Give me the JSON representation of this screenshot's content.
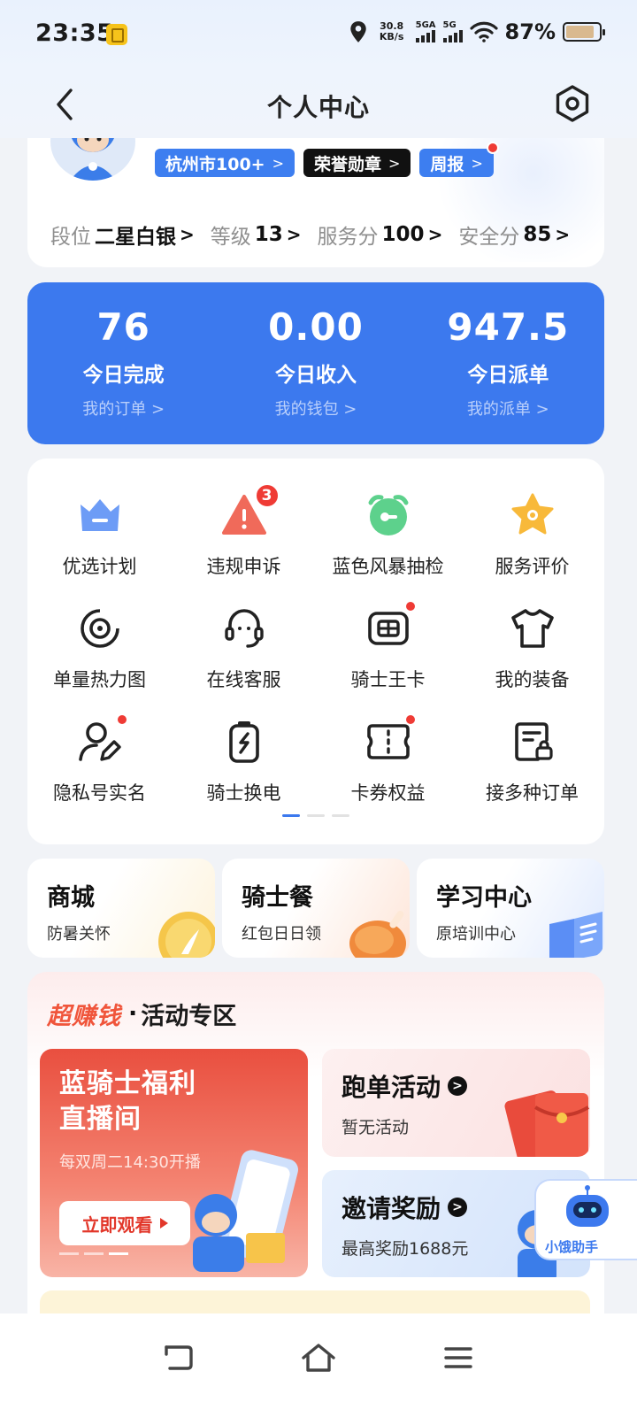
{
  "status_bar": {
    "time": "23:35",
    "net_speed_value": "30.8",
    "net_speed_unit": "KB/s",
    "sim1_label": "5GA",
    "sim2_label": "5G",
    "battery_percent": "87%",
    "battery_level": 0.87
  },
  "header": {
    "title": "个人中心"
  },
  "profile": {
    "tags": [
      {
        "label": "杭州市100+"
      },
      {
        "label": "荣誉勋章"
      },
      {
        "label": "周报"
      }
    ],
    "stats": [
      {
        "label": "段位",
        "value": "二星白银"
      },
      {
        "label": "等级",
        "value": "13"
      },
      {
        "label": "服务分",
        "value": "100"
      },
      {
        "label": "安全分",
        "value": "85"
      }
    ]
  },
  "today": [
    {
      "number": "76",
      "name": "今日完成",
      "link": "我的订单 >"
    },
    {
      "number": "0.00",
      "name": "今日收入",
      "link": "我的钱包 >"
    },
    {
      "number": "947.5",
      "name": "今日派单",
      "link": "我的派单 >"
    }
  ],
  "grid_items": [
    {
      "label": "优选计划",
      "icon": "crown-icon"
    },
    {
      "label": "违规申诉",
      "icon": "warning-icon",
      "badge": "3"
    },
    {
      "label": "蓝色风暴抽检",
      "icon": "alarm-clock-icon"
    },
    {
      "label": "服务评价",
      "icon": "star-badge-icon"
    },
    {
      "label": "单量热力图",
      "icon": "target-icon"
    },
    {
      "label": "在线客服",
      "icon": "headset-icon"
    },
    {
      "label": "骑士王卡",
      "icon": "sim-card-icon"
    },
    {
      "label": "我的装备",
      "icon": "tshirt-icon"
    },
    {
      "label": "隐私号实名",
      "icon": "user-edit-icon"
    },
    {
      "label": "骑士换电",
      "icon": "battery-swap-icon"
    },
    {
      "label": "卡券权益",
      "icon": "coupon-icon"
    },
    {
      "label": "接多种订单",
      "icon": "order-lock-icon"
    }
  ],
  "features": [
    {
      "title": "商城",
      "subtitle": "防暑关怀"
    },
    {
      "title": "骑士餐",
      "subtitle": "红包日日领"
    },
    {
      "title": "学习中心",
      "subtitle": "原培训中心"
    }
  ],
  "promo": {
    "title_highlight": "超赚钱",
    "title_dot": "·",
    "title_text": "活动专区",
    "live": {
      "line1": "蓝骑士福利",
      "line2": "直播间",
      "schedule": "每双周二14:30开播",
      "button": "立即观看"
    },
    "activities": [
      {
        "title": "跑单活动",
        "subtitle": "暂无活动"
      },
      {
        "title": "邀请奖励",
        "subtitle": "最高奖励1688元"
      }
    ]
  },
  "assistant": {
    "label": "小饿助手"
  },
  "colors": {
    "primary": "#3c79ee",
    "alert": "#ef3b35",
    "promo_red": "#e94f3f"
  }
}
